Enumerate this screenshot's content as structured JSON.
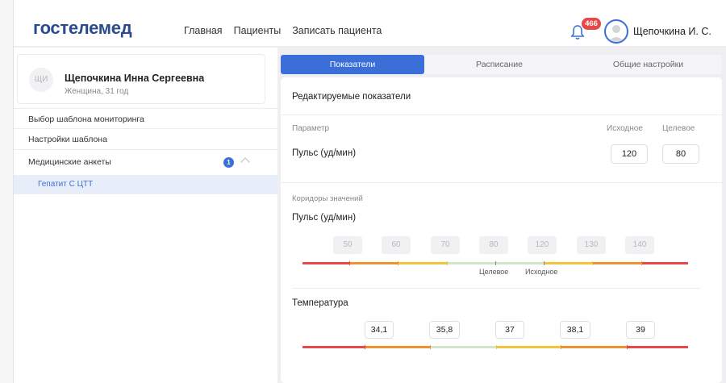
{
  "header": {
    "logo": "гостелемед",
    "nav": [
      "Главная",
      "Пациенты",
      "Записать пациента"
    ],
    "notifications_count": "466",
    "user_name": "Щепочкина И. С."
  },
  "patient": {
    "initials": "ЩИ",
    "full_name": "Щепочкина Инна Сергеевна",
    "info": "Женщина, 31 год"
  },
  "sidebar": {
    "items": [
      {
        "label": "Выбор шаблона мониторинга"
      },
      {
        "label": "Настройки шаблона"
      },
      {
        "label": "Медицинские анкеты",
        "count": "1"
      }
    ],
    "sub_items": [
      "Гепатит С ЦТТ"
    ]
  },
  "tabs": [
    "Показатели",
    "Расписание",
    "Общие настройки"
  ],
  "panel": {
    "title": "Редактируемые показатели",
    "param_header": "Параметр",
    "initial_header": "Исходное",
    "target_header": "Целевое",
    "row": {
      "name": "Пульс (уд/мин)",
      "initial": "120",
      "target": "80"
    },
    "corridors_label": "Коридоры значений",
    "pulse": {
      "title": "Пульс (уд/мин)",
      "values": [
        "50",
        "60",
        "70",
        "80",
        "120",
        "130",
        "140"
      ],
      "target_label": "Целевое",
      "initial_label": "Исходное"
    },
    "temperature": {
      "title": "Температура",
      "values": [
        "34,1",
        "35,8",
        "37",
        "38,1",
        "39"
      ]
    }
  },
  "colors": {
    "brand": "#2a4b8d",
    "accent": "#3a6fd8",
    "red": "#e8484a",
    "orange": "#f0912f",
    "yellow": "#f1c43c",
    "green": "#cfe6c8"
  }
}
